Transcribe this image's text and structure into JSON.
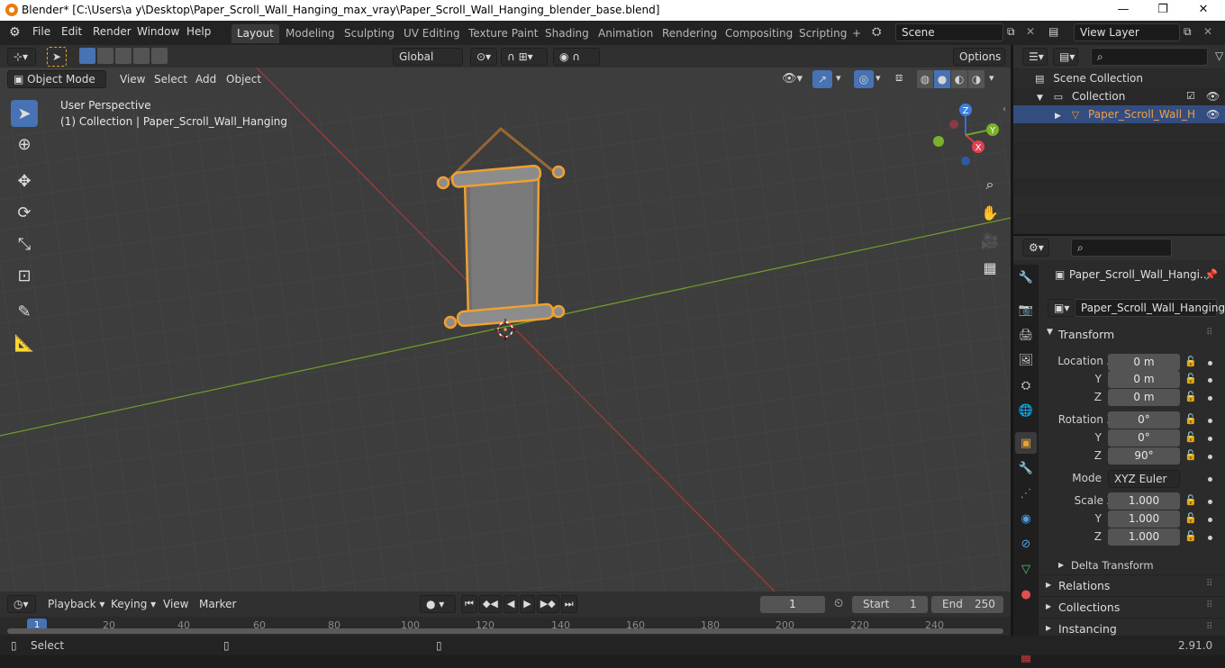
{
  "window": {
    "title": "Blender* [C:\\Users\\a y\\Desktop\\Paper_Scroll_Wall_Hanging_max_vray\\Paper_Scroll_Wall_Hanging_blender_base.blend]",
    "minimize": "—",
    "maximize": "❐",
    "close": "✕"
  },
  "menubar": {
    "menus": [
      "File",
      "Edit",
      "Render",
      "Window",
      "Help"
    ],
    "workspaces": [
      "Layout",
      "Modeling",
      "Sculpting",
      "UV Editing",
      "Texture Paint",
      "Shading",
      "Animation",
      "Rendering",
      "Compositing",
      "Scripting"
    ],
    "active_workspace": "Layout",
    "add_tab": "+",
    "scene": "Scene",
    "view_layer": "View Layer"
  },
  "tool_header": {
    "orientation": "Global",
    "options": "Options"
  },
  "viewport_header": {
    "mode": "Object Mode",
    "menus": [
      "View",
      "Select",
      "Add",
      "Object"
    ]
  },
  "viewport": {
    "perspective": "User Perspective",
    "collection_info": "(1) Collection | Paper_Scroll_Wall_Hanging",
    "gizmo": {
      "x": "X",
      "y": "Y",
      "z": "Z"
    }
  },
  "outliner": {
    "items": [
      {
        "label": "Scene Collection"
      },
      {
        "label": "Collection"
      },
      {
        "label": "Paper_Scroll_Wall_H"
      }
    ]
  },
  "properties": {
    "object_name": "Paper_Scroll_Wall_Hangi...",
    "object_field": "Paper_Scroll_Wall_Hanging",
    "transform": {
      "header": "Transform",
      "location_label": "Location X",
      "rotation_label": "Rotation X",
      "scale_label": "Scale X",
      "y_label": "Y",
      "z_label": "Z",
      "location": [
        "0 m",
        "0 m",
        "0 m"
      ],
      "rotation": [
        "0°",
        "0°",
        "90°"
      ],
      "mode_label": "Mode",
      "mode": "XYZ Euler",
      "scale": [
        "1.000",
        "1.000",
        "1.000"
      ],
      "delta": "Delta Transform"
    },
    "sections": [
      "Relations",
      "Collections",
      "Instancing"
    ]
  },
  "timeline": {
    "menus": [
      "Playback",
      "Keying",
      "View",
      "Marker"
    ],
    "current_frame": "1",
    "start_label": "Start",
    "start": "1",
    "end_label": "End",
    "end": "250",
    "ticks": [
      "1",
      "20",
      "40",
      "60",
      "80",
      "100",
      "120",
      "140",
      "160",
      "180",
      "200",
      "220",
      "240"
    ]
  },
  "statusbar": {
    "left": "Select",
    "version": "2.91.0"
  }
}
